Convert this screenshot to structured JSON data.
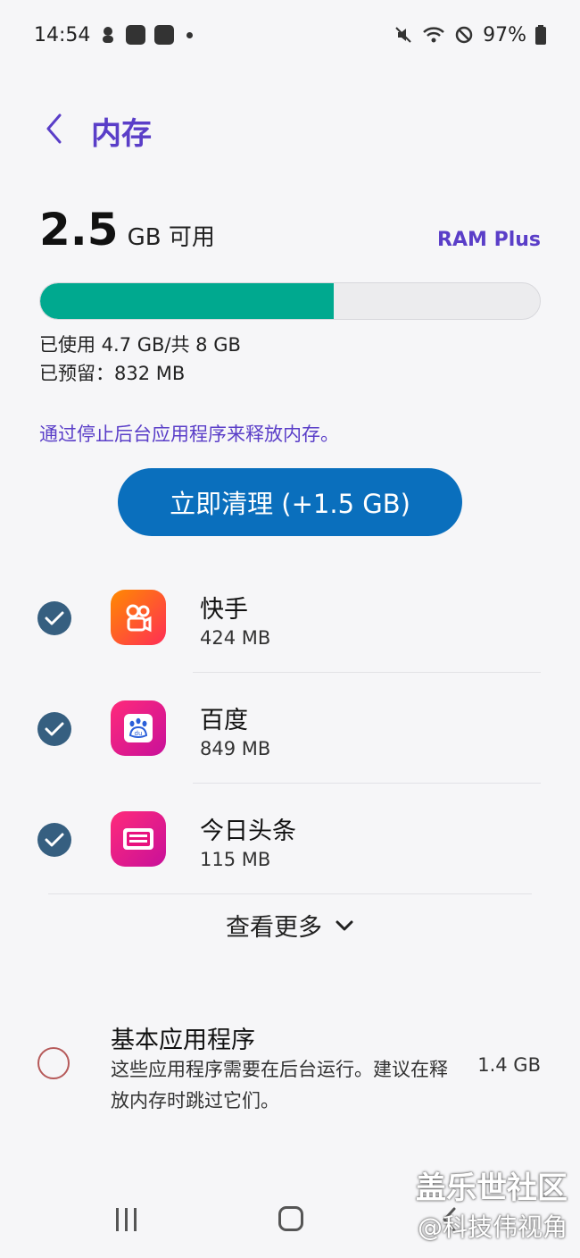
{
  "status_bar": {
    "time": "14:54",
    "battery": "97%",
    "icons": [
      "notification-icon",
      "app-icon",
      "app-icon",
      "dot-icon",
      "mute-icon",
      "wifi-icon",
      "dnd-icon",
      "battery-icon"
    ]
  },
  "header": {
    "back_icon": "chevron-left-icon",
    "title": "内存"
  },
  "memory": {
    "available_value": "2.5",
    "available_unit": "GB 可用",
    "ram_plus_label": "RAM Plus",
    "used_fraction": 0.5875,
    "used_text": "已使用 4.7 GB/共 8 GB",
    "reserved_text": "已预留：832 MB",
    "hint_text": "通过停止后台应用程序来释放内存。",
    "clean_button_label": "立即清理 (+1.5 GB)"
  },
  "apps": [
    {
      "name": "快手",
      "size": "424 MB",
      "checked": true,
      "icon": "kuaishou-icon",
      "color": "#ff4a2e"
    },
    {
      "name": "百度",
      "size": "849 MB",
      "checked": true,
      "icon": "baidu-icon",
      "color": "#e8127e"
    },
    {
      "name": "今日头条",
      "size": "115 MB",
      "checked": true,
      "icon": "toutiao-icon",
      "color": "#e8127e"
    }
  ],
  "see_more_label": "查看更多",
  "essential": {
    "title": "基本应用程序",
    "description": "这些应用程序需要在后台运行。建议在释放内存时跳过它们。",
    "size": "1.4 GB",
    "checked": false
  },
  "watermark": {
    "line1": "盖乐世社区",
    "line2": "@科技伟视角"
  },
  "colors": {
    "accent": "#5a3ec8",
    "progress": "#00a98f",
    "button": "#0a6fbd",
    "checkbox": "#365f80"
  }
}
